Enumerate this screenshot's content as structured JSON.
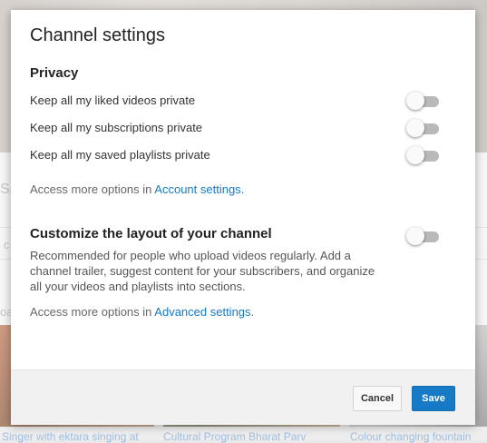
{
  "background": {
    "fragments": [
      "Sa",
      "c",
      "oa"
    ],
    "thumbnail_captions": [
      "Singer with ektara singing at",
      "Cultural Program Bharat Parv",
      "Colour changing fountain"
    ]
  },
  "dialog": {
    "title": "Channel settings",
    "privacy": {
      "heading": "Privacy",
      "items": [
        {
          "label": "Keep all my liked videos private",
          "enabled": false
        },
        {
          "label": "Keep all my subscriptions private",
          "enabled": false
        },
        {
          "label": "Keep all my saved playlists private",
          "enabled": false
        }
      ],
      "more_prefix": "Access more options in ",
      "more_link": "Account settings",
      "more_suffix": "."
    },
    "layout": {
      "heading": "Customize the layout of your channel",
      "enabled": false,
      "description": "Recommended for people who upload videos regularly. Add a channel trailer, suggest content for your subscribers, and organize all your videos and playlists into sections.",
      "more_prefix": "Access more options in ",
      "more_link": "Advanced settings",
      "more_suffix": "."
    },
    "buttons": {
      "cancel": "Cancel",
      "save": "Save"
    }
  },
  "colors": {
    "link": "#167ac6",
    "save_button": "#167ac6",
    "toggle_off_track": "#b9b9b9"
  }
}
